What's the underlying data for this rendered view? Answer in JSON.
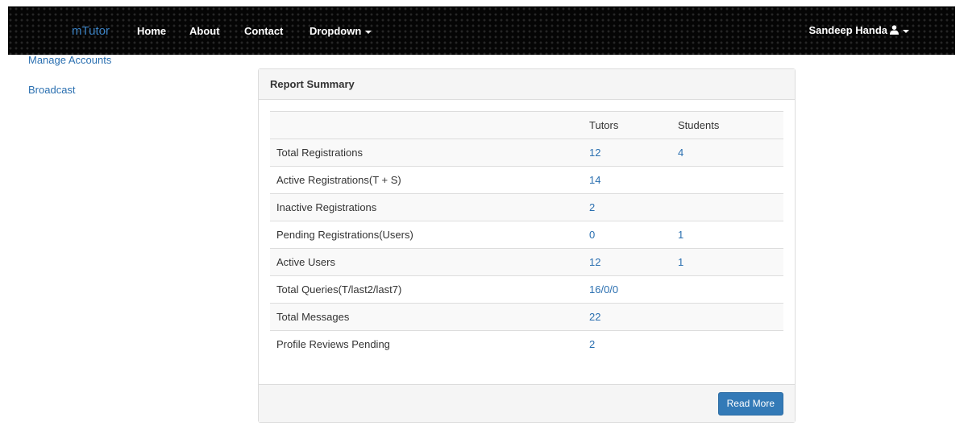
{
  "nav": {
    "brand": "mTutor",
    "links": [
      "Home",
      "About",
      "Contact"
    ],
    "dropdown": "Dropdown",
    "user": "Sandeep Handa"
  },
  "sidebar": {
    "items": [
      "Manage Accounts",
      "Broadcast"
    ]
  },
  "panel": {
    "title": "Report Summary",
    "columns": [
      "",
      "Tutors",
      "Students"
    ],
    "rows": [
      {
        "label": "Total Registrations",
        "tutors": "12",
        "students": "4"
      },
      {
        "label": "Active Registrations(T + S)",
        "tutors": "14",
        "students": ""
      },
      {
        "label": "Inactive Registrations",
        "tutors": "2",
        "students": ""
      },
      {
        "label": "Pending Registrations(Users)",
        "tutors": "0",
        "students": "1"
      },
      {
        "label": "Active Users",
        "tutors": "12",
        "students": "1"
      },
      {
        "label": "Total Queries(T/last2/last7)",
        "tutors": "16/0/0",
        "students": ""
      },
      {
        "label": "Total Messages",
        "tutors": "22",
        "students": ""
      },
      {
        "label": "Profile Reviews Pending",
        "tutors": "2",
        "students": ""
      }
    ],
    "button": "Read More"
  }
}
